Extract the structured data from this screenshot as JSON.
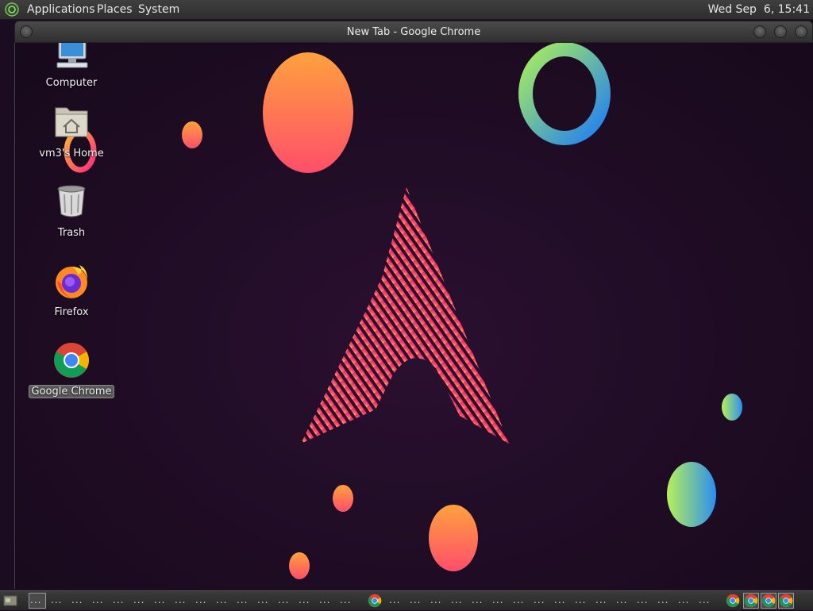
{
  "top_panel": {
    "menus": [
      "Applications",
      "Places",
      "System"
    ],
    "clock": "Wed Sep  6, 15:41"
  },
  "window": {
    "title": "New Tab - Google Chrome"
  },
  "desktop": {
    "icons": [
      {
        "label": "Computer",
        "icon": "computer-icon"
      },
      {
        "label": "vm3's Home",
        "icon": "home-folder-icon"
      },
      {
        "label": "Trash",
        "icon": "trash-icon"
      },
      {
        "label": "Firefox",
        "icon": "firefox-icon"
      },
      {
        "label": "Google Chrome",
        "icon": "chrome-icon",
        "selected": true
      }
    ]
  },
  "bottom_panel": {
    "dots": "..."
  },
  "colors": {
    "panel": "#3a3a3a",
    "wallpaper": "#1f0c24",
    "accent_pink": "#e0216e",
    "accent_orange": "#ff8a3c"
  }
}
